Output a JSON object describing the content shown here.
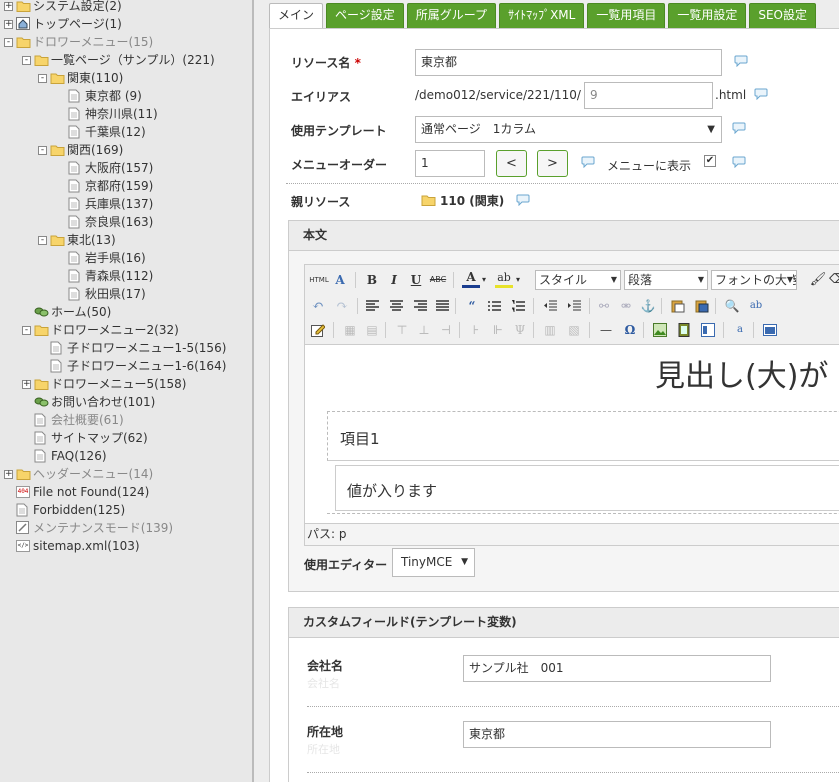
{
  "tree": {
    "items": [
      {
        "label": "システム設定(2)",
        "level": 0,
        "toggle": "+",
        "icon": "folder"
      },
      {
        "label": "トップページ(1)",
        "level": 0,
        "toggle": "+",
        "icon": "home"
      },
      {
        "label": "ドロワーメニュー(15)",
        "level": 0,
        "toggle": "-",
        "icon": "folder",
        "dim": true
      },
      {
        "label": "一覧ページ（サンプル）(221)",
        "level": 1,
        "toggle": "-",
        "icon": "folder"
      },
      {
        "label": "関東(110)",
        "level": 2,
        "toggle": "-",
        "icon": "folder"
      },
      {
        "label": "東京都 (9)",
        "level": 3,
        "icon": "page"
      },
      {
        "label": "神奈川県(11)",
        "level": 3,
        "icon": "page"
      },
      {
        "label": "千葉県(12)",
        "level": 3,
        "icon": "page"
      },
      {
        "label": "関西(169)",
        "level": 2,
        "toggle": "-",
        "icon": "folder"
      },
      {
        "label": "大阪府(157)",
        "level": 3,
        "icon": "page"
      },
      {
        "label": "京都府(159)",
        "level": 3,
        "icon": "page"
      },
      {
        "label": "兵庫県(137)",
        "level": 3,
        "icon": "page"
      },
      {
        "label": "奈良県(163)",
        "level": 3,
        "icon": "page"
      },
      {
        "label": "東北(13)",
        "level": 2,
        "toggle": "-",
        "icon": "folder"
      },
      {
        "label": "岩手県(16)",
        "level": 3,
        "icon": "page"
      },
      {
        "label": "青森県(112)",
        "level": 3,
        "icon": "page"
      },
      {
        "label": "秋田県(17)",
        "level": 3,
        "icon": "page"
      },
      {
        "label": "ホーム(50)",
        "level": 1,
        "icon": "link"
      },
      {
        "label": "ドロワーメニュー2(32)",
        "level": 1,
        "toggle": "-",
        "icon": "folder"
      },
      {
        "label": "子ドロワーメニュー1-5(156)",
        "level": 2,
        "icon": "page"
      },
      {
        "label": "子ドロワーメニュー1-6(164)",
        "level": 2,
        "icon": "page"
      },
      {
        "label": "ドロワーメニュー5(158)",
        "level": 1,
        "toggle": "+",
        "icon": "folder"
      },
      {
        "label": "お問い合わせ(101)",
        "level": 1,
        "icon": "link"
      },
      {
        "label": "会社概要(61)",
        "level": 1,
        "icon": "page",
        "dim": true
      },
      {
        "label": "サイトマップ(62)",
        "level": 1,
        "icon": "page"
      },
      {
        "label": "FAQ(126)",
        "level": 1,
        "icon": "page"
      },
      {
        "label": "ヘッダーメニュー(14)",
        "level": 0,
        "toggle": "+",
        "icon": "folder",
        "dim": true
      },
      {
        "label": "File not Found(124)",
        "level": 0,
        "icon": "404"
      },
      {
        "label": "Forbidden(125)",
        "level": 0,
        "icon": "page"
      },
      {
        "label": "メンテナンスモード(139)",
        "level": 0,
        "icon": "maint",
        "dim": true
      },
      {
        "label": "sitemap.xml(103)",
        "level": 0,
        "icon": "xml"
      }
    ]
  },
  "tabs": [
    {
      "label": "メイン",
      "active": true
    },
    {
      "label": "ページ設定"
    },
    {
      "label": "所属グループ"
    },
    {
      "label": "ｻｲﾄﾏｯﾌﾟXML"
    },
    {
      "label": "一覧用項目"
    },
    {
      "label": "一覧用設定"
    },
    {
      "label": "SEO設定"
    }
  ],
  "form": {
    "resource_name_label": "リソース名",
    "required_mark": "*",
    "resource_name_value": "東京都",
    "alias_label": "エイリアス",
    "alias_prefix": "/demo012/service/221/110/",
    "alias_value": "9",
    "alias_suffix": ".html",
    "template_label": "使用テンプレート",
    "template_value": "通常ページ　1カラム",
    "menu_order_label": "メニューオーダー",
    "menu_order_value": "1",
    "prev_label": "<",
    "next_label": ">",
    "show_in_menu_label": "メニューに表示",
    "show_in_menu_checked": "✔",
    "parent_label": "親リソース",
    "parent_value": "110 (関東)"
  },
  "editor": {
    "section_title": "本文",
    "style_select": "スタイル",
    "format_select": "段落",
    "font_size_select": "フォントの大き",
    "heading_text": "見出し(大)が",
    "item_title": "項目1",
    "item_value": "値が入ります",
    "path_text": "パス: p",
    "editor_label": "使用エディター",
    "editor_value": "TinyMCE"
  },
  "custom_fields": {
    "section_title": "カスタムフィールド(テンプレート変数)",
    "fields": [
      {
        "label": "会社名",
        "sub": "会社名",
        "value": "サンプル社　001"
      },
      {
        "label": "所在地",
        "sub": "所在地",
        "value": "東京都"
      }
    ]
  }
}
